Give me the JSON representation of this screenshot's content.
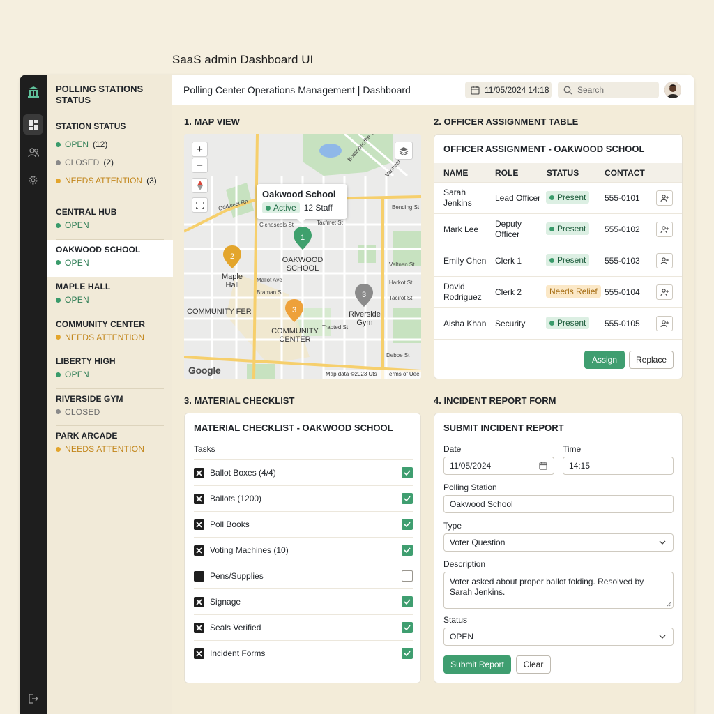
{
  "caption": "SaaS admin Dashboard UI",
  "sidebar": {
    "title": "POLLING STATIONS STATUS",
    "summary_heading": "STATION STATUS",
    "summary": [
      {
        "label": "OPEN",
        "count": "(12)",
        "color": "#3a9b6b"
      },
      {
        "label": "CLOSED",
        "count": "(2)",
        "color": "#8a8a8a"
      },
      {
        "label": "NEEDS ATTENTION",
        "count": "(3)",
        "color": "#e3a52c"
      }
    ],
    "stations": [
      {
        "name": "CENTRAL HUB",
        "status": "OPEN"
      },
      {
        "name": "OAKWOOD SCHOOL",
        "status": "OPEN"
      },
      {
        "name": "MAPLE HALL",
        "status": "OPEN"
      },
      {
        "name": "COMMUNITY CENTER",
        "status": "NEEDS ATTENTION"
      },
      {
        "name": "LIBERTY HIGH",
        "status": "OPEN"
      },
      {
        "name": "RIVERSIDE GYM",
        "status": "CLOSED"
      },
      {
        "name": "PARK ARCADE",
        "status": "NEEDS ATTENTION"
      }
    ]
  },
  "header": {
    "title": "Polling Center Operations Management | Dashboard",
    "datetime": "11/05/2024 14:18",
    "search_placeholder": "Search"
  },
  "map_section": {
    "title": "1. MAP VIEW",
    "popup": {
      "name": "Oakwood School",
      "status": "Active",
      "staff": "12 Staff"
    },
    "markers": [
      {
        "num": "1",
        "label": "OAKWOOD SCHOOL"
      },
      {
        "num": "2",
        "label": "Maple Hall"
      },
      {
        "num": "3",
        "label": "COMMUNITY CENTER"
      },
      {
        "num": "3",
        "label": "Riverside Gym"
      }
    ],
    "area_label": "COMMUNITY FER",
    "streets": [
      "Oddiseci Rn",
      "Cichoseols St",
      "Mallot Ave",
      "Braman St",
      "Bending St",
      "Veltnen St",
      "Harkot St",
      "Tacirot St",
      "Debbe St",
      "Traoted St",
      "Tacfmet St",
      "Bossnoenthe St",
      "Vanhaer St"
    ],
    "google": "Google",
    "attribution": "Map data ©2023 Uts",
    "terms": "Terms of Uee"
  },
  "officer_section": {
    "title": "2. OFFICER ASSIGNMENT TABLE",
    "card_title": "OFFICER ASSIGNMENT - OAKWOOD SCHOOL",
    "columns": [
      "NAME",
      "ROLE",
      "STATUS",
      "CONTACT"
    ],
    "rows": [
      {
        "name": "Sarah Jenkins",
        "role": "Lead Officer",
        "status": "Present",
        "contact": "555-0101"
      },
      {
        "name": "Mark Lee",
        "role": "Deputy Officer",
        "status": "Present",
        "contact": "555-0102"
      },
      {
        "name": "Emily Chen",
        "role": "Clerk 1",
        "status": "Present",
        "contact": "555-0103"
      },
      {
        "name": "David Rodriguez",
        "role": "Clerk 2",
        "status": "Needs Relief",
        "contact": "555-0104"
      },
      {
        "name": "Aisha Khan",
        "role": "Security",
        "status": "Present",
        "contact": "555-0105"
      }
    ],
    "assign_label": "Assign",
    "replace_label": "Replace"
  },
  "checklist_section": {
    "title": "3. MATERIAL CHECKLIST",
    "card_title": "MATERIAL CHECKLIST - OAKWOOD SCHOOL",
    "tasks_label": "Tasks",
    "items": [
      {
        "label": "Ballot Boxes (4/4)",
        "checked": true
      },
      {
        "label": "Ballots (1200)",
        "checked": true
      },
      {
        "label": "Poll Books",
        "checked": true
      },
      {
        "label": "Voting Machines (10)",
        "checked": true
      },
      {
        "label": "Pens/Supplies",
        "checked": false
      },
      {
        "label": "Signage",
        "checked": true
      },
      {
        "label": "Seals Verified",
        "checked": true
      },
      {
        "label": "Incident Forms",
        "checked": true
      }
    ]
  },
  "incident_section": {
    "title": "4. INCIDENT REPORT FORM",
    "card_title": "SUBMIT INCIDENT REPORT",
    "date_label": "Date",
    "date_value": "11/05/2024",
    "time_label": "Time",
    "time_value": "14:15",
    "station_label": "Polling Station",
    "station_value": "Oakwood School",
    "type_label": "Type",
    "type_value": "Voter Question",
    "description_label": "Description",
    "description_value": "Voter asked about proper ballot folding. Resolved by Sarah Jenkins.",
    "status_label": "Status",
    "status_value": "OPEN",
    "submit_label": "Submit Report",
    "clear_label": "Clear"
  },
  "colors": {
    "open": "#3a9b6b",
    "closed": "#8a8a8a",
    "attention": "#e3a52c",
    "accent": "#3f9e70"
  }
}
